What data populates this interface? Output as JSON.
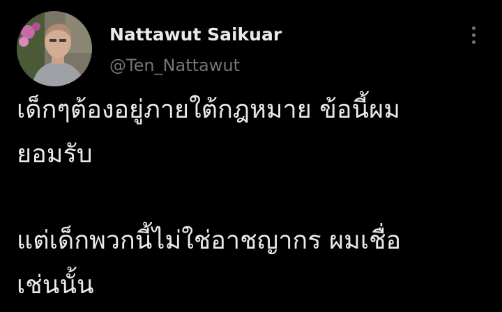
{
  "author": {
    "display_name": "Nattawut Saikuar",
    "handle": "@Ten_Nattawut",
    "avatar_icon": "profile-photo"
  },
  "menu": {
    "more_icon": "more-vertical-icon"
  },
  "tweet": {
    "lines": [
      "เด็กๆต้องอยู่ภายใต้กฎหมาย ข้อนี้ผม",
      "ยอมรับ",
      "แต่เด็กพวกนี้ไม่ใช่อาชญากร ผมเชื่อ",
      "เช่นนั้น"
    ]
  },
  "colors": {
    "background": "#000000",
    "primary_text": "#e7e9ea",
    "secondary_text": "#71767b"
  }
}
